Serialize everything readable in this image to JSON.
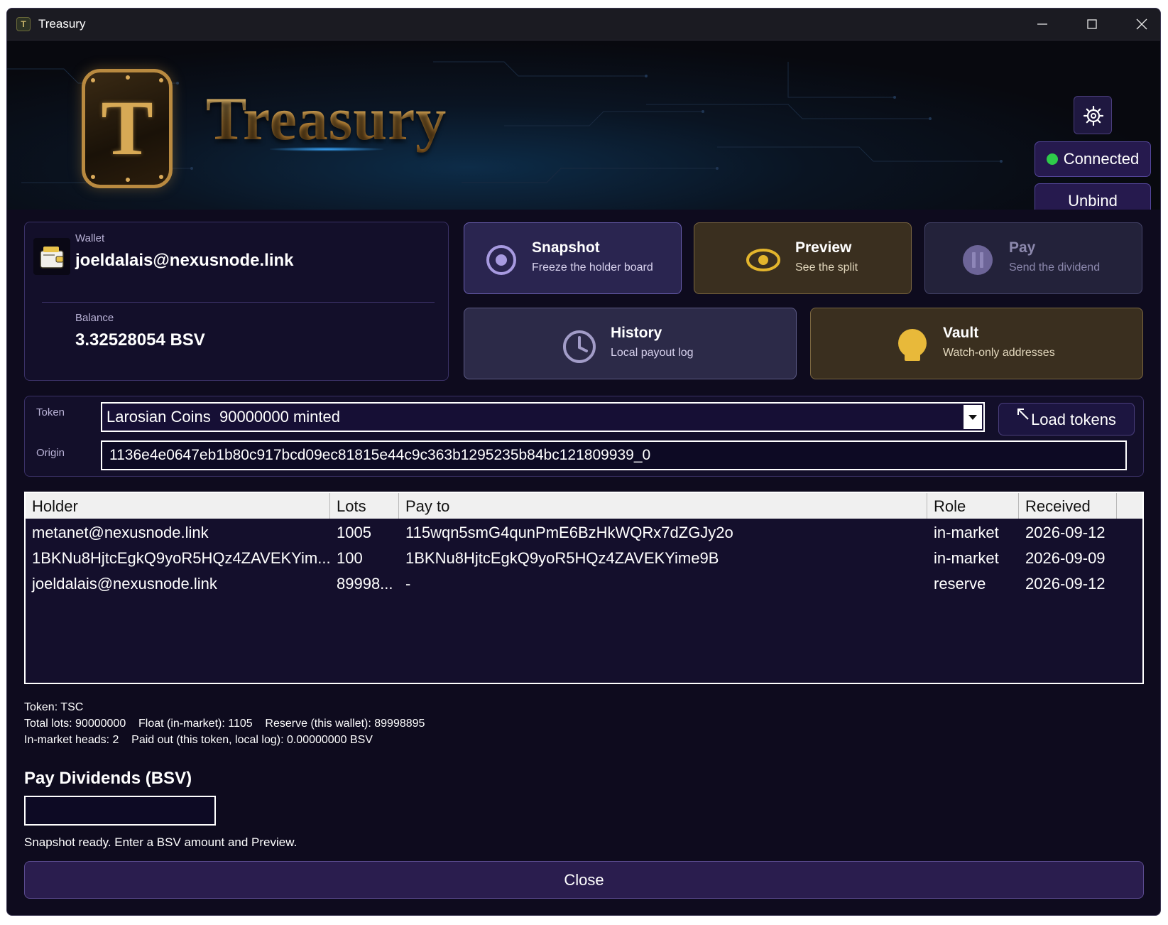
{
  "window": {
    "title": "Treasury"
  },
  "banner": {
    "brand": "Treasury",
    "logo_letter": "T"
  },
  "header": {
    "connected_label": "Connected",
    "unbind_label": "Unbind",
    "status_color": "#2ecc4a"
  },
  "wallet": {
    "wallet_label": "Wallet",
    "wallet_value": "joeldalais@nexusnode.link",
    "balance_label": "Balance",
    "balance_value": "3.32528054 BSV"
  },
  "actions": {
    "snapshot": {
      "title": "Snapshot",
      "subtitle": "Freeze the holder board",
      "icon": "target-icon"
    },
    "preview": {
      "title": "Preview",
      "subtitle": "See the split",
      "icon": "eye-icon"
    },
    "pay": {
      "title": "Pay",
      "subtitle": "Send the dividend",
      "icon": "pause-icon",
      "enabled": false
    },
    "history": {
      "title": "History",
      "subtitle": "Local payout log",
      "icon": "clock-icon"
    },
    "vault": {
      "title": "Vault",
      "subtitle": "Watch-only addresses",
      "icon": "vault-icon"
    }
  },
  "token": {
    "token_label": "Token",
    "selected": "Larosian Coins  90000000 minted",
    "load_label": "Load tokens",
    "origin_label": "Origin",
    "origin_value": "1136e4e0647eb1b80c917bcd09ec81815e44c9c363b1295235b84bc121809939_0"
  },
  "table": {
    "columns": [
      "Holder",
      "Lots",
      "Pay to",
      "Role",
      "Received"
    ],
    "rows": [
      [
        "metanet@nexusnode.link",
        "1005",
        "115wqn5smG4qunPmE6BzHkWQRx7dZGJy2o",
        "in-market",
        "2026-09-12"
      ],
      [
        "1BKNu8HjtcEgkQ9yoR5HQz4ZAVEKYim...",
        "100",
        "1BKNu8HjtcEgkQ9yoR5HQz4ZAVEKYime9B",
        "in-market",
        "2026-09-09"
      ],
      [
        "joeldalais@nexusnode.link",
        "89998...",
        "-",
        "reserve",
        "2026-09-12"
      ]
    ]
  },
  "stats": {
    "line1": "Token: TSC",
    "line2": "Total lots: 90000000    Float (in-market): 1105    Reserve (this wallet): 89998895",
    "line3": "In-market heads: 2    Paid out (this token, local log): 0.00000000 BSV"
  },
  "dividends": {
    "title": "Pay Dividends (BSV)",
    "amount_value": "",
    "status": "Snapshot ready. Enter a BSV amount and Preview."
  },
  "footer": {
    "close_label": "Close"
  }
}
